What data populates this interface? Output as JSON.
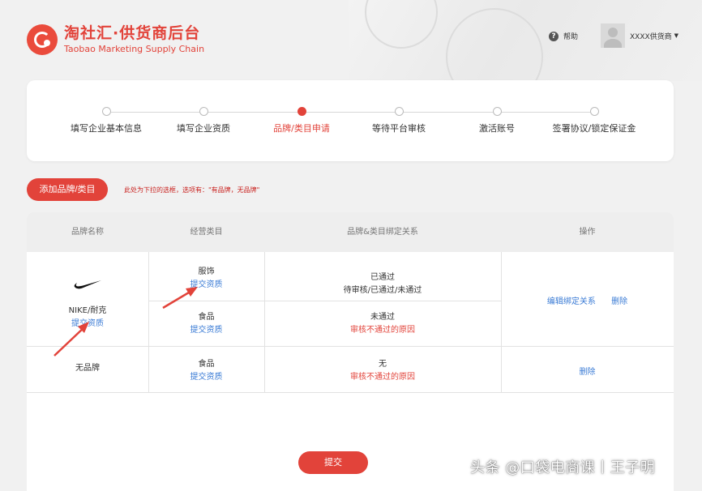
{
  "header": {
    "logo_title": "淘社汇·供货商后台",
    "logo_subtitle": "Taobao Marketing Supply Chain",
    "help_label": "帮助",
    "user_name": "XXXX供货商"
  },
  "steps": [
    {
      "label": "填写企业基本信息",
      "active": false
    },
    {
      "label": "填写企业资质",
      "active": false
    },
    {
      "label": "品牌/类目申请",
      "active": true
    },
    {
      "label": "等待平台审核",
      "active": false
    },
    {
      "label": "激活账号",
      "active": false
    },
    {
      "label": "签署协议/锁定保证金",
      "active": false
    }
  ],
  "toolbar": {
    "add_label": "添加品牌/类目",
    "note": "此处为下拉的选框，选项有：\"有品牌，无品牌\""
  },
  "table": {
    "headers": [
      "品牌名称",
      "经营类目",
      "品牌&类目绑定关系",
      "操作"
    ],
    "rows": [
      {
        "brand": "NIKE/耐克",
        "brand_link": "提交资质",
        "categories": [
          {
            "name": "服饰",
            "link": "提交资质",
            "status": "已通过",
            "detail": "待审核/已通过/未通过",
            "detail_is_error": false
          },
          {
            "name": "食品",
            "link": "提交资质",
            "status": "未通过",
            "detail": "审核不通过的原因",
            "detail_is_error": true
          }
        ],
        "actions": [
          "编辑绑定关系",
          "删除"
        ]
      },
      {
        "brand": "无品牌",
        "categories": [
          {
            "name": "食品",
            "link": "提交资质",
            "status": "无",
            "detail": "审核不通过的原因",
            "detail_is_error": true
          }
        ],
        "actions": [
          "删除"
        ]
      }
    ]
  },
  "submit_label": "提交",
  "watermark": "头条 @口袋电商课丨王子明",
  "colors": {
    "accent": "#e2433a",
    "link": "#3a7bd5",
    "background": "#f1f1f1"
  }
}
